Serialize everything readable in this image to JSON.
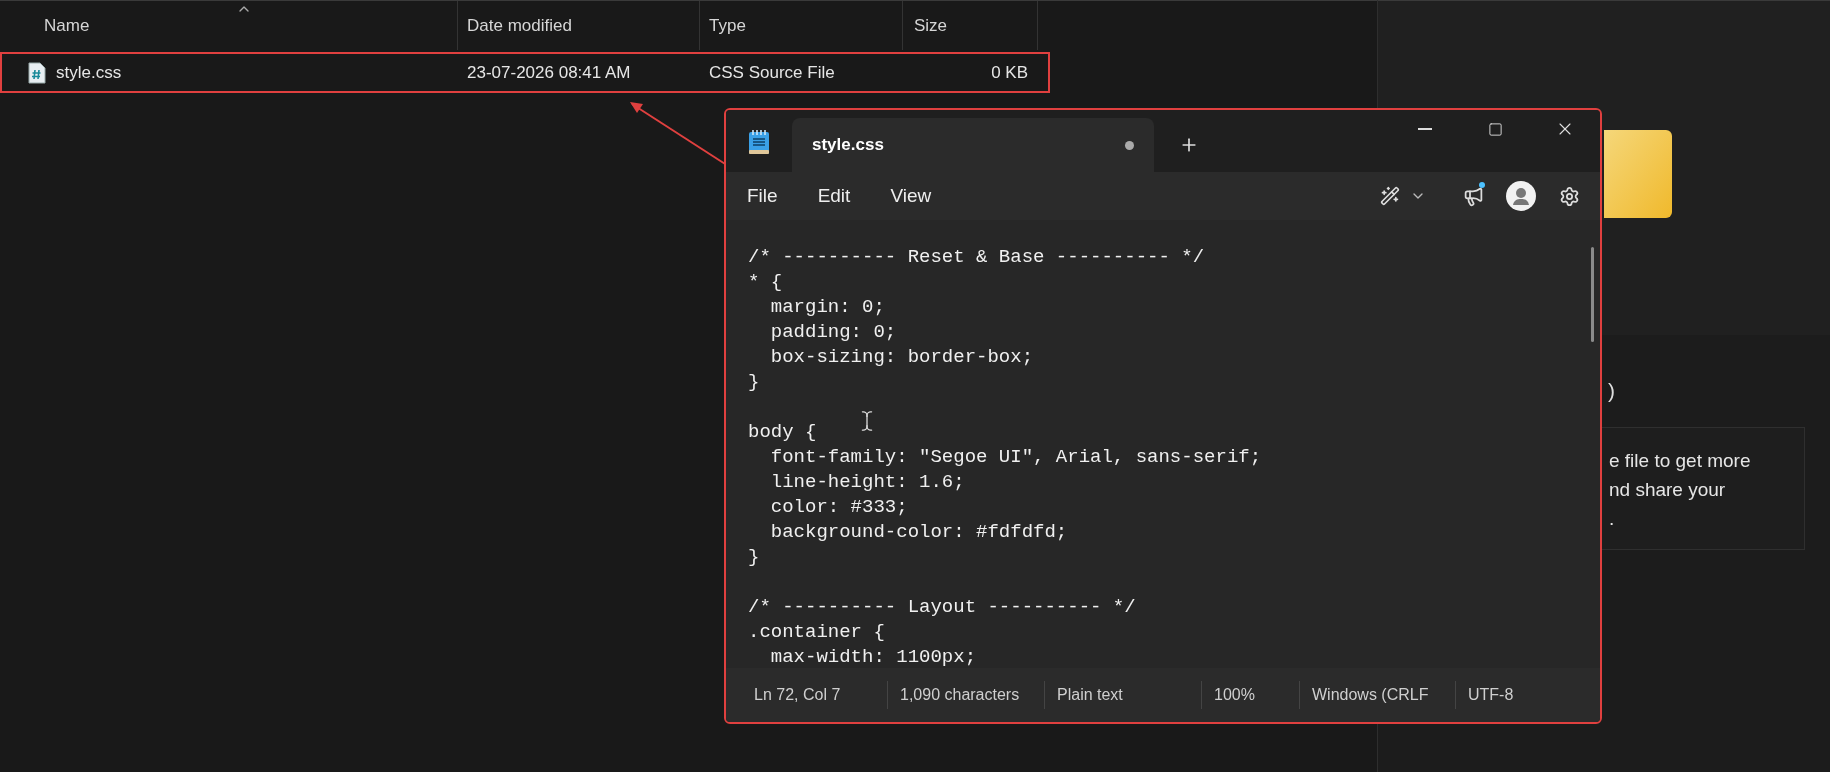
{
  "explorer": {
    "columns": [
      {
        "label": "Name",
        "sorted": true
      },
      {
        "label": "Date modified",
        "sorted": false
      },
      {
        "label": "Type",
        "sorted": false
      },
      {
        "label": "Size",
        "sorted": false
      }
    ],
    "rows": [
      {
        "name": "style.css",
        "date": "23-07-2026 08:41 AM",
        "type": "CSS Source File",
        "size": "0 KB",
        "highlighted": true
      }
    ]
  },
  "details_pane": {
    "heading_fragment": ")",
    "card_lines": [
      "e file to get more",
      "nd share your",
      "."
    ]
  },
  "notepad": {
    "tabs": [
      {
        "label": "style.css",
        "selected": true,
        "unsaved": true
      }
    ],
    "menu": [
      "File",
      "Edit",
      "View"
    ],
    "has_notification": true,
    "code_blocks": [
      [
        "/* ---------- Reset & Base ---------- */",
        "* {",
        "  margin: 0;",
        "  padding: 0;",
        "  box-sizing: border-box;",
        "}"
      ],
      [
        "body {",
        "  font-family: \"Segoe UI\", Arial, sans-serif;",
        "  line-height: 1.6;",
        "  color: #333;",
        "  background-color: #fdfdfd;",
        "}"
      ],
      [
        "/* ---------- Layout ---------- */",
        ".container {",
        "  max-width: 1100px;"
      ]
    ],
    "status_bar": [
      "Ln 72, Col 7",
      "1,090 characters",
      "Plain text",
      "100%",
      "Windows (CRLF",
      "UTF-8"
    ]
  }
}
